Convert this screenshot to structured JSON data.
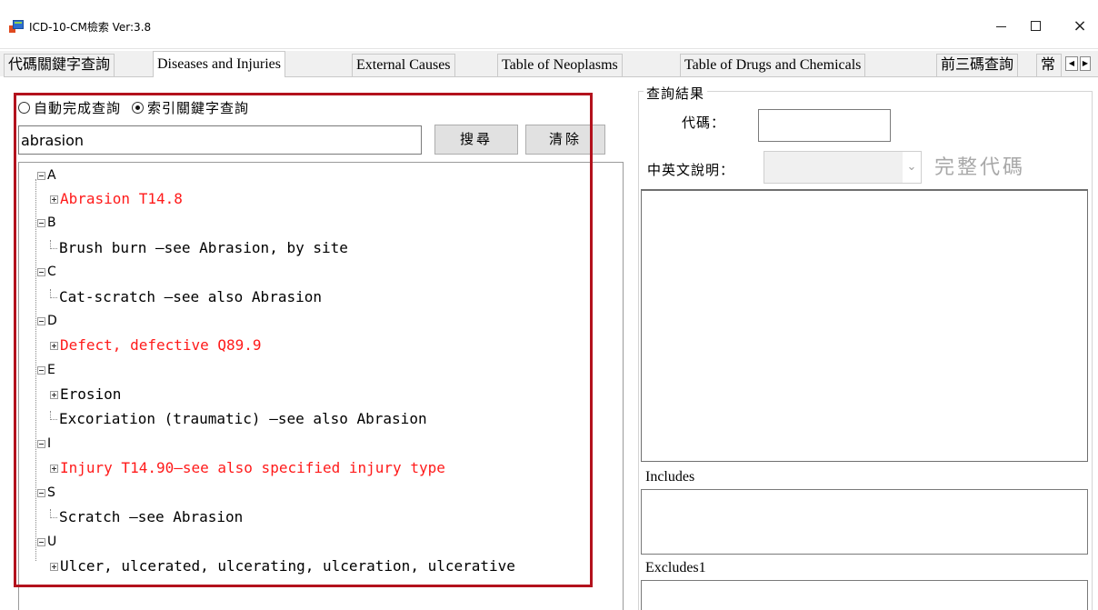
{
  "window": {
    "title": "ICD-10-CM檢索  Ver:3.8",
    "minimize": "–",
    "maximize": "□",
    "close": "×"
  },
  "tabs": [
    {
      "label": "代碼關鍵字查詢"
    },
    {
      "label": "Diseases and Injuries",
      "active": true
    },
    {
      "label": "External Causes"
    },
    {
      "label": "Table of Neoplasms"
    },
    {
      "label": "Table of Drugs and Chemicals"
    },
    {
      "label": "前三碼查詢"
    },
    {
      "label": "常"
    }
  ],
  "tab_scroll": {
    "left": "◀",
    "right": "▶"
  },
  "search_mode": {
    "option1": "自動完成查詢",
    "option2": "索引關鍵字查詢",
    "selected": "索引關鍵字查詢"
  },
  "search": {
    "value": "abrasion",
    "search_button": "搜尋",
    "clear_button": "清除"
  },
  "tree": [
    {
      "letter": "A",
      "children": [
        {
          "text": "Abrasion  T14.8",
          "red": true,
          "expandable": true
        }
      ]
    },
    {
      "letter": "B",
      "children": [
        {
          "text": "Brush burn  —see Abrasion, by site",
          "red": false,
          "expandable": false
        }
      ]
    },
    {
      "letter": "C",
      "children": [
        {
          "text": "Cat-scratch  —see also Abrasion",
          "red": false,
          "expandable": false
        }
      ]
    },
    {
      "letter": "D",
      "children": [
        {
          "text": "Defect, defective  Q89.9",
          "red": true,
          "expandable": true
        }
      ]
    },
    {
      "letter": "E",
      "children": [
        {
          "text": "Erosion",
          "red": false,
          "expandable": true
        },
        {
          "text": "Excoriation (traumatic) —see also Abrasion",
          "red": false,
          "expandable": false
        }
      ]
    },
    {
      "letter": "I",
      "children": [
        {
          "text": "Injury  T14.90—see also specified injury type",
          "red": true,
          "expandable": true
        }
      ]
    },
    {
      "letter": "S",
      "children": [
        {
          "text": "Scratch  —see Abrasion",
          "red": false,
          "expandable": false
        }
      ]
    },
    {
      "letter": "U",
      "children": [
        {
          "text": "Ulcer, ulcerated, ulcerating, ulceration, ulcerative",
          "red": false,
          "expandable": true
        }
      ]
    }
  ],
  "results": {
    "group_title": "查詢結果",
    "code_label": "代碼：",
    "code_value": "",
    "desc_label": "中英文說明：",
    "combo_value": "",
    "full_code_label": "完整代碼",
    "includes_label": "Includes",
    "excludes_label": "Excludes1"
  },
  "colors": {
    "highlight_border": "#b3121d",
    "red_entry": "#ff1a1a"
  }
}
